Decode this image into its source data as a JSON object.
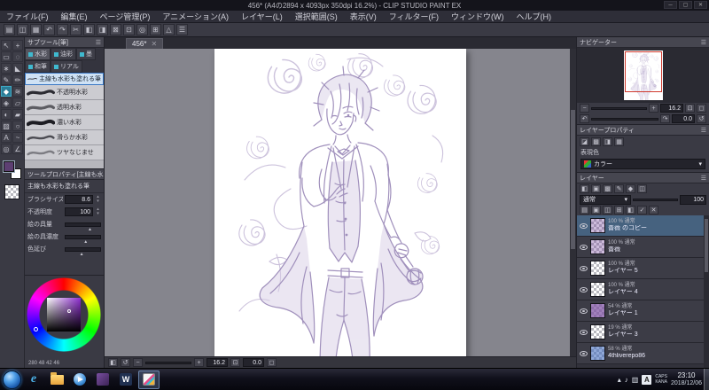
{
  "window": {
    "title": "456* (A4の2894 x 4093px 350dpi 16.2%) - CLIP STUDIO PAINT EX",
    "minimize": "─",
    "maximize": "▢",
    "close": "✕"
  },
  "ui": {
    "panel_menu": "☰",
    "dropdown_arrow": "▾",
    "spin_up": "▴",
    "spin_down": "▾",
    "slider_thumb": "▲",
    "close": "✕"
  },
  "menu": {
    "items": [
      "ファイル(F)",
      "編集(E)",
      "ページ管理(P)",
      "アニメーション(A)",
      "レイヤー(L)",
      "選択範囲(S)",
      "表示(V)",
      "フィルター(F)",
      "ウィンドウ(W)",
      "ヘルプ(H)"
    ]
  },
  "toolbar": {
    "icons": [
      {
        "name": "new-file",
        "glyph": "▤"
      },
      {
        "name": "open-file",
        "glyph": "◫"
      },
      {
        "name": "save-file",
        "glyph": "▦"
      },
      {
        "name": "undo",
        "glyph": "↶"
      },
      {
        "name": "redo",
        "glyph": "↷"
      },
      {
        "name": "cut",
        "glyph": "✂"
      },
      {
        "name": "copy",
        "glyph": "◧"
      },
      {
        "name": "paste",
        "glyph": "◨"
      },
      {
        "name": "delete",
        "glyph": "⊠"
      },
      {
        "name": "deselect",
        "glyph": "⊡"
      },
      {
        "name": "zoom",
        "glyph": "◎"
      },
      {
        "name": "grid",
        "glyph": "⊞"
      },
      {
        "name": "ruler",
        "glyph": "△"
      },
      {
        "name": "settings",
        "glyph": "☰"
      }
    ]
  },
  "toolstrip": {
    "tools": [
      {
        "name": "object-tool",
        "glyph": "↖"
      },
      {
        "name": "move-tool",
        "glyph": "+"
      },
      {
        "name": "marquee-tool",
        "glyph": "▭"
      },
      {
        "name": "lasso-tool",
        "glyph": "◌"
      },
      {
        "name": "wand-tool",
        "glyph": "∗"
      },
      {
        "name": "eyedropper-tool",
        "glyph": "◣"
      },
      {
        "name": "pen-tool",
        "glyph": "✎"
      },
      {
        "name": "pencil-tool",
        "glyph": "✏"
      },
      {
        "name": "brush-tool",
        "glyph": "◆"
      },
      {
        "name": "airbrush-tool",
        "glyph": "≋"
      },
      {
        "name": "decoration-tool",
        "glyph": "◈"
      },
      {
        "name": "eraser-tool",
        "glyph": "▱"
      },
      {
        "name": "blend-tool",
        "glyph": "◐"
      },
      {
        "name": "fill-tool",
        "glyph": "▰"
      },
      {
        "name": "gradient-tool",
        "glyph": "▨"
      },
      {
        "name": "figure-tool",
        "glyph": "○"
      },
      {
        "name": "text-tool",
        "glyph": "A"
      },
      {
        "name": "line-correct-tool",
        "glyph": "~"
      },
      {
        "name": "zoom-tool",
        "glyph": "◎"
      },
      {
        "name": "ruler-tool",
        "glyph": "∠"
      }
    ]
  },
  "subtool": {
    "title": "サブツール[筆]",
    "tabs": [
      "水彩",
      "油彩",
      "墨",
      "和筆",
      "リアル"
    ],
    "selected_brush": "主線も水彩も塗れる筆",
    "brushes": [
      "不透明水彩",
      "透明水彩",
      "濃い水彩",
      "滑らか水彩",
      "ツヤなじませ"
    ]
  },
  "tool_property": {
    "title": "ツールプロパティ[主線も水彩も塗れる筆]",
    "brush_name": "主線も水彩も塗れる筆",
    "props": [
      {
        "label": "ブラシサイズ",
        "value": "8.6"
      },
      {
        "label": "不透明度",
        "value": "100"
      },
      {
        "label": "絵の具量",
        "value": ""
      },
      {
        "label": "絵の具濃度",
        "value": ""
      },
      {
        "label": "色延び",
        "value": ""
      }
    ]
  },
  "color_wheel": {
    "values": "280 48 42 46"
  },
  "canvas": {
    "tab": "456*",
    "zoom": "16.2",
    "rotation": "0.0"
  },
  "canvasbar": {
    "icons": [
      {
        "name": "flip-view",
        "glyph": "◧"
      },
      {
        "name": "rotate-view",
        "glyph": "↺"
      },
      {
        "name": "zoom-out",
        "glyph": "−"
      },
      {
        "name": "zoom-in",
        "glyph": "+"
      },
      {
        "name": "fit-screen",
        "glyph": "⊡"
      },
      {
        "name": "actual-pixels",
        "glyph": "◻"
      }
    ]
  },
  "navigator": {
    "title": "ナビゲーター",
    "zoom": "16.2",
    "rotation": "0.0",
    "icons": [
      {
        "name": "zoom-out",
        "glyph": "−"
      },
      {
        "name": "zoom-in",
        "glyph": "+"
      },
      {
        "name": "fit",
        "glyph": "⊡"
      },
      {
        "name": "actual-size",
        "glyph": "◻"
      },
      {
        "name": "rotate-left",
        "glyph": "↶"
      },
      {
        "name": "rotate-right",
        "glyph": "↷"
      },
      {
        "name": "reset-rotation",
        "glyph": "↺"
      }
    ]
  },
  "layer_property": {
    "title": "レイヤープロパティ",
    "expression_label": "表現色",
    "expression_value": "カラー",
    "icons": [
      {
        "name": "border-effect",
        "glyph": "◪"
      },
      {
        "name": "tone",
        "glyph": "▩"
      },
      {
        "name": "layer-color",
        "glyph": "◨"
      },
      {
        "name": "expression-color",
        "glyph": "▦"
      }
    ]
  },
  "layer_panel": {
    "title": "レイヤー",
    "blend_mode": "通常",
    "opacity": "100",
    "top_icons": [
      {
        "name": "clip-at-layer",
        "glyph": "◧"
      },
      {
        "name": "lock-layer",
        "glyph": "▣"
      },
      {
        "name": "lock-alpha",
        "glyph": "▩"
      },
      {
        "name": "set-draft",
        "glyph": "✎"
      },
      {
        "name": "layer-color",
        "glyph": "◆"
      },
      {
        "name": "enable-mask",
        "glyph": "◫"
      }
    ],
    "cmd_icons": [
      {
        "name": "new-layer",
        "glyph": "▤"
      },
      {
        "name": "new-folder",
        "glyph": "▣"
      },
      {
        "name": "duplicate-layer",
        "glyph": "◫"
      },
      {
        "name": "merge-down",
        "glyph": "⊞"
      },
      {
        "name": "create-mask",
        "glyph": "◧"
      },
      {
        "name": "apply-mask",
        "glyph": "✓"
      },
      {
        "name": "delete-layer",
        "glyph": "✕"
      }
    ],
    "layers": [
      {
        "meta": "100 % 通常",
        "name": "薔薇 のコピー"
      },
      {
        "meta": "100 % 通常",
        "name": "薔薇"
      },
      {
        "meta": "100 % 通常",
        "name": "レイヤー 5"
      },
      {
        "meta": "100 % 通常",
        "name": "レイヤー 4"
      },
      {
        "meta": "54 % 通常",
        "name": "レイヤー 1"
      },
      {
        "meta": "19 % 通常",
        "name": "レイヤー 3"
      },
      {
        "meta": "58 % 通常",
        "name": "4thliverepo86"
      }
    ]
  },
  "taskbar": {
    "time": "23:10",
    "date": "2018/12/06",
    "ime": "A",
    "caps": "CAPS",
    "kana": "KANA"
  }
}
